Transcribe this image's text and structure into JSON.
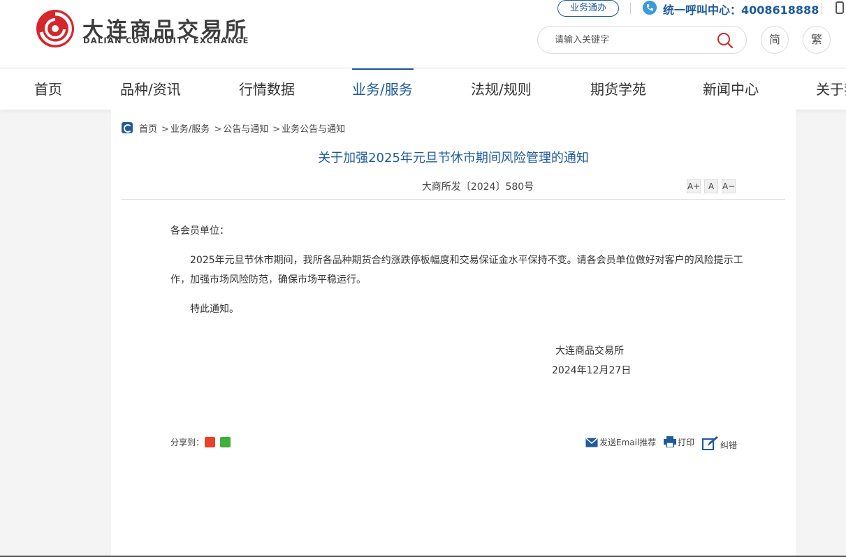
{
  "header": {
    "logo_cn": "大连商品交易所",
    "logo_en": "DALIAN COMMODITY EXCHANGE",
    "biz_button": "业务通办",
    "hotline": "统一呼叫中心：4008618888",
    "search_placeholder": "请输入关键字",
    "lang_simplified": "简",
    "lang_traditional": "繁",
    "brand_red": "#d7262b",
    "brand_blue": "#1e5a9c"
  },
  "nav": {
    "items": [
      "首页",
      "品种/资讯",
      "行情数据",
      "业务/服务",
      "法规/规则",
      "期货学苑",
      "新闻中心",
      "关于我"
    ],
    "active": "业务/服务"
  },
  "breadcrumb": [
    "首页",
    "业务/服务",
    "公告与通知",
    "业务公告与通知"
  ],
  "breadcrumb_sep": ">",
  "article": {
    "title": "关于加强2025年元旦节休市期间风险管理的通知",
    "doc_no": "大商所发〔2024〕580号",
    "font_controls": [
      "A+",
      "A",
      "A−"
    ],
    "salutation": "各会员单位：",
    "paragraph": "2025年元旦节休市期间，我所各品种期货合约涨跌停板幅度和交易保证金水平保持不变。请各会员单位做好对客户的风险提示工作，加强市场风险防范，确保市场平稳运行。",
    "closing": "特此通知。",
    "signature_org": "大连商品交易所",
    "signature_date": "2024年12月27日"
  },
  "footer_actions": {
    "share_label": "分享到：",
    "email": "发送Email推荐",
    "print": "打印",
    "correct": "纠错"
  }
}
